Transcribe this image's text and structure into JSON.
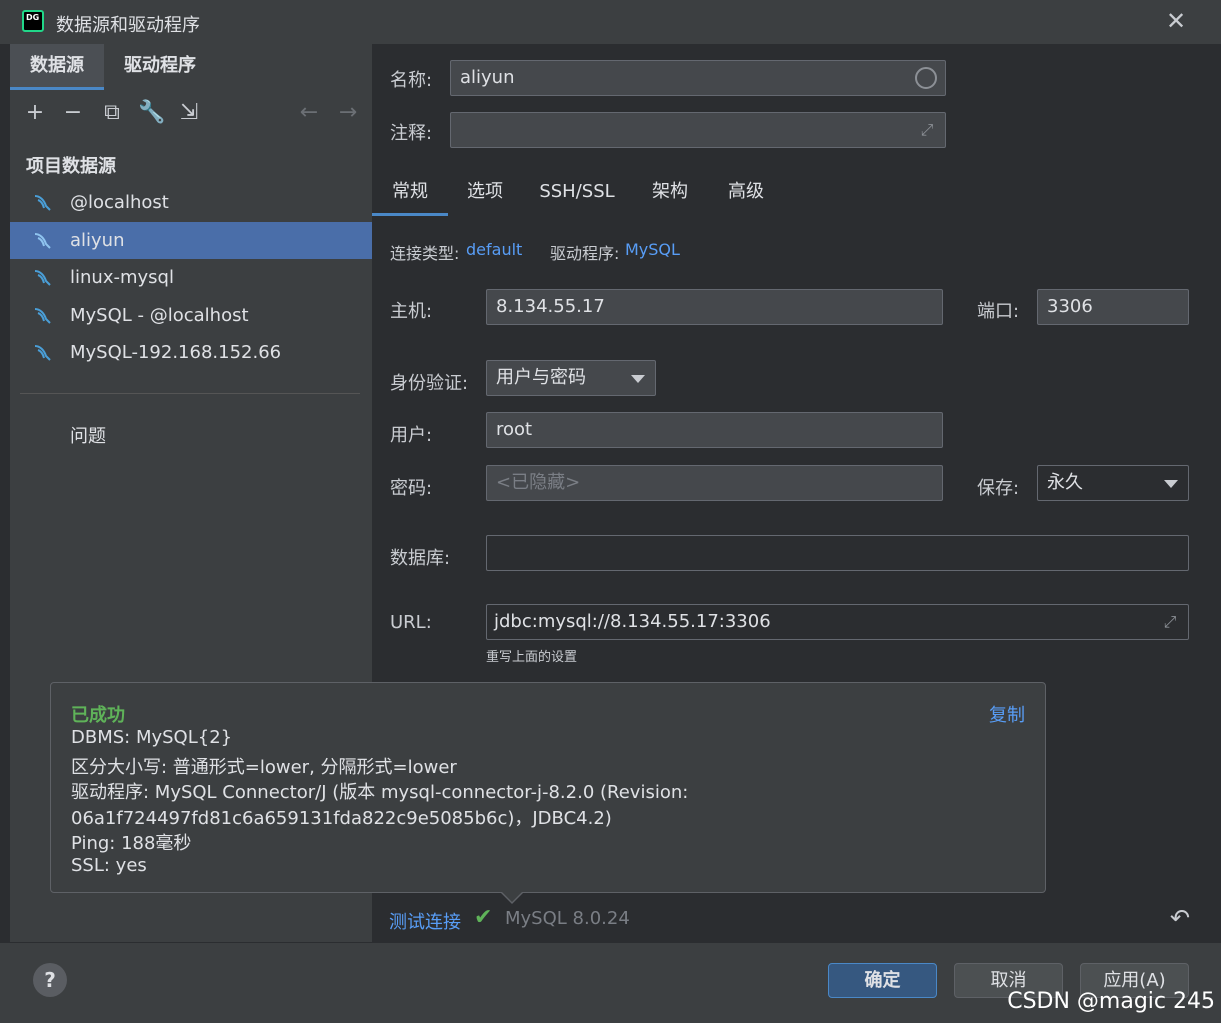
{
  "window": {
    "title": "数据源和驱动程序",
    "app_icon": "DG"
  },
  "left": {
    "tabs": [
      {
        "label": "数据源"
      },
      {
        "label": "驱动程序"
      }
    ],
    "toolbar": {
      "icons": [
        "plus-icon",
        "minus-icon",
        "copy-icon",
        "wrench-icon",
        "import-icon",
        "arrow-left-icon",
        "arrow-right-icon"
      ]
    },
    "section_title": "项目数据源",
    "items": [
      {
        "label": "@localhost"
      },
      {
        "label": "aliyun"
      },
      {
        "label": "linux-mysql"
      },
      {
        "label": "MySQL - @localhost"
      },
      {
        "label": "MySQL-192.168.152.66"
      }
    ],
    "problems": "问题"
  },
  "form": {
    "name_label": "名称:",
    "name_value": "aliyun",
    "comment_label": "注释:",
    "comment_value": "",
    "tabs": [
      {
        "label": "常规"
      },
      {
        "label": "选项"
      },
      {
        "label": "SSH/SSL"
      },
      {
        "label": "架构"
      },
      {
        "label": "高级"
      }
    ],
    "conn_type_label": "连接类型:",
    "conn_type_value": "default",
    "driver_label": "驱动程序:",
    "driver_value": "MySQL",
    "host_label": "主机:",
    "host_value": "8.134.55.17",
    "port_label": "端口:",
    "port_value": "3306",
    "auth_label": "身份验证:",
    "auth_value": "用户与密码",
    "user_label": "用户:",
    "user_value": "root",
    "password_label": "密码:",
    "password_placeholder": "<已隐藏>",
    "save_label": "保存:",
    "save_value": "永久",
    "database_label": "数据库:",
    "database_value": "",
    "url_label": "URL:",
    "url_value": "jdbc:mysql://8.134.55.17:3306",
    "url_hint": "重写上面的设置"
  },
  "popup": {
    "status": "已成功",
    "copy": "复制",
    "lines": [
      "DBMS: MySQL{2}",
      "区分大小写: 普通形式=lower, 分隔形式=lower",
      "驱动程序: MySQL Connector/J (版本 mysql-connector-j-8.2.0 (Revision:",
      "06a1f724497fd81c6a659131fda822c9e5085b6c)，JDBC4.2)",
      "Ping: 188毫秒",
      "SSL: yes"
    ]
  },
  "test": {
    "link": "测试连接",
    "version": "MySQL 8.0.24"
  },
  "buttons": {
    "help": "?",
    "ok": "确定",
    "cancel": "取消",
    "apply": "应用(A)"
  },
  "watermark": "CSDN @magic 245"
}
